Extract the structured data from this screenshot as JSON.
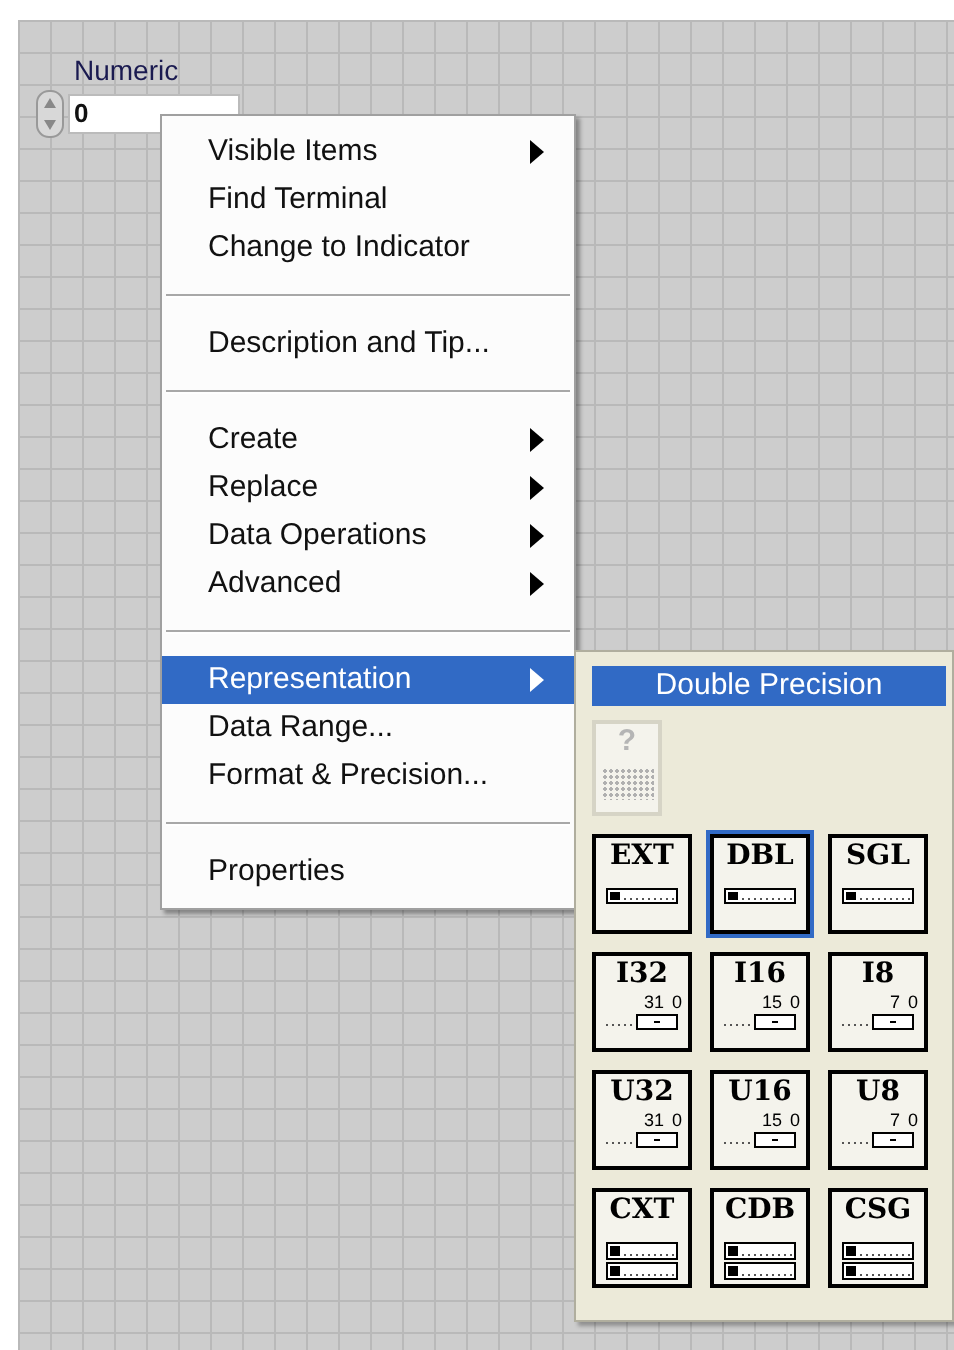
{
  "numeric": {
    "label": "Numeric",
    "value": "0"
  },
  "menu": [
    {
      "kind": "item",
      "label": "Visible Items",
      "submenu": true,
      "selected": false
    },
    {
      "kind": "item",
      "label": "Find Terminal",
      "submenu": false,
      "selected": false
    },
    {
      "kind": "item",
      "label": "Change to Indicator",
      "submenu": false,
      "selected": false
    },
    {
      "kind": "separator"
    },
    {
      "kind": "item",
      "label": "Description and Tip...",
      "submenu": false,
      "selected": false
    },
    {
      "kind": "separator"
    },
    {
      "kind": "item",
      "label": "Create",
      "submenu": true,
      "selected": false
    },
    {
      "kind": "item",
      "label": "Replace",
      "submenu": true,
      "selected": false
    },
    {
      "kind": "item",
      "label": "Data Operations",
      "submenu": true,
      "selected": false
    },
    {
      "kind": "item",
      "label": "Advanced",
      "submenu": true,
      "selected": false
    },
    {
      "kind": "separator"
    },
    {
      "kind": "item",
      "label": "Representation",
      "submenu": true,
      "selected": true
    },
    {
      "kind": "item",
      "label": "Data Range...",
      "submenu": false,
      "selected": false
    },
    {
      "kind": "item",
      "label": "Format & Precision...",
      "submenu": false,
      "selected": false
    },
    {
      "kind": "separator"
    },
    {
      "kind": "item",
      "label": "Properties",
      "submenu": false,
      "selected": false
    }
  ],
  "representation": {
    "title": "Double Precision",
    "unknown": {
      "label": "?",
      "disabled": true
    },
    "tiles": [
      {
        "kind": "float",
        "label": "EXT",
        "selected": false
      },
      {
        "kind": "float",
        "label": "DBL",
        "selected": true
      },
      {
        "kind": "float",
        "label": "SGL",
        "selected": false
      },
      {
        "kind": "int",
        "label": "I32",
        "selected": false,
        "bits": [
          "31",
          "0"
        ]
      },
      {
        "kind": "int",
        "label": "I16",
        "selected": false,
        "bits": [
          "15",
          "0"
        ]
      },
      {
        "kind": "int",
        "label": "I8",
        "selected": false,
        "bits": [
          "7",
          "0"
        ]
      },
      {
        "kind": "int",
        "label": "U32",
        "selected": false,
        "bits": [
          "31",
          "0"
        ]
      },
      {
        "kind": "int",
        "label": "U16",
        "selected": false,
        "bits": [
          "15",
          "0"
        ]
      },
      {
        "kind": "int",
        "label": "U8",
        "selected": false,
        "bits": [
          "7",
          "0"
        ]
      },
      {
        "kind": "complex",
        "label": "CXT",
        "selected": false
      },
      {
        "kind": "complex",
        "label": "CDB",
        "selected": false
      },
      {
        "kind": "complex",
        "label": "CSG",
        "selected": false
      }
    ]
  }
}
